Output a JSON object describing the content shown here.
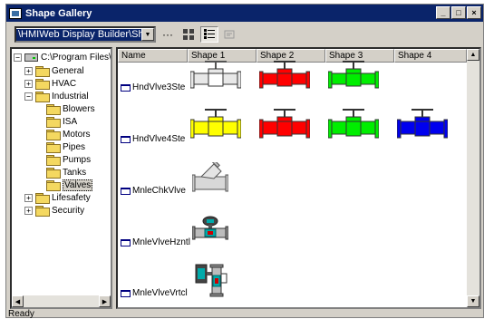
{
  "window": {
    "title": "Shape Gallery",
    "buttons": [
      "_",
      "□",
      "×"
    ]
  },
  "toolbar": {
    "path_value": "\\HMIWeb Display Builder\\ShapeLib\\",
    "browse_label": "···",
    "icons": [
      "large-icons-view-icon",
      "details-view-icon",
      "disabled-tool-icon"
    ]
  },
  "tree": {
    "root": "C:\\Program Files\\H",
    "items": [
      {
        "label": "General",
        "expander": "+"
      },
      {
        "label": "HVAC",
        "expander": "+"
      },
      {
        "label": "Industrial",
        "expander": "−"
      },
      {
        "label": "Blowers",
        "expander": ""
      },
      {
        "label": "ISA",
        "expander": ""
      },
      {
        "label": "Motors",
        "expander": ""
      },
      {
        "label": "Pipes",
        "expander": ""
      },
      {
        "label": "Pumps",
        "expander": ""
      },
      {
        "label": "Tanks",
        "expander": ""
      },
      {
        "label": "Valves",
        "expander": ""
      },
      {
        "label": "Lifesafety",
        "expander": "+"
      },
      {
        "label": "Security",
        "expander": "+"
      }
    ],
    "selected": "Valves"
  },
  "list": {
    "columns": [
      "Name",
      "Shape 1",
      "Shape 2",
      "Shape 3",
      "Shape 4"
    ],
    "rows": [
      {
        "name": "HndVlve3Ste",
        "shapes": [
          "gray-gate-valve",
          "red-gate-valve",
          "green-gate-valve"
        ]
      },
      {
        "name": "HndVlve4Ste",
        "shapes": [
          "yellow-gate-valve",
          "red-gate-valve",
          "green-gate-valve",
          "blue-gate-valve"
        ]
      },
      {
        "name": "MnleChkVlve",
        "shapes": [
          "check-valve"
        ]
      },
      {
        "name": "MnleVlveHzntl",
        "shapes": [
          "motorized-horizontal-valve"
        ]
      },
      {
        "name": "MnleVlveVrtcl",
        "shapes": [
          "motorized-vertical-valve"
        ]
      }
    ]
  },
  "colors": {
    "gray": "#e8e8e8",
    "red": "#ff0000",
    "green": "#00ee00",
    "yellow": "#ffff00",
    "blue": "#0000ee",
    "title_bar": "#0a246a"
  },
  "status": {
    "text": "Ready"
  }
}
